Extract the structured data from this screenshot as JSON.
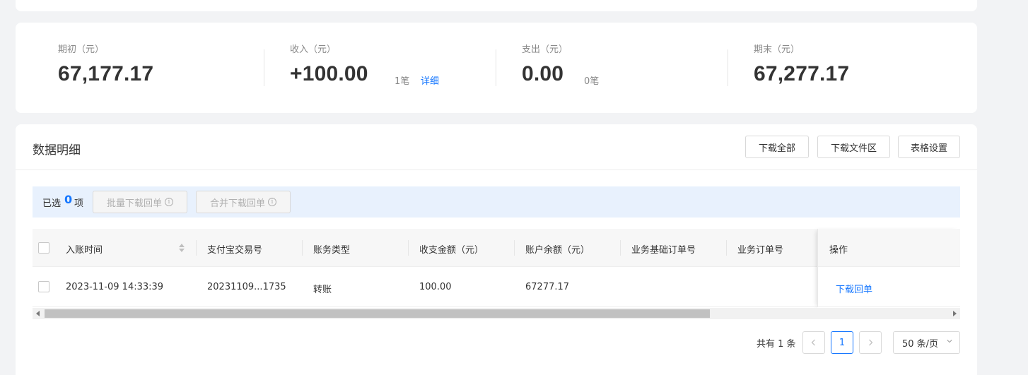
{
  "summary": {
    "opening": {
      "label": "期初（元）",
      "value": "67,177.17"
    },
    "income": {
      "label": "收入（元）",
      "value": "+100.00",
      "count": "1笔",
      "link": "详细"
    },
    "expense": {
      "label": "支出（元）",
      "value": "0.00",
      "count": "0笔"
    },
    "closing": {
      "label": "期末（元）",
      "value": "67,277.17"
    }
  },
  "detail": {
    "title": "数据明细",
    "buttons": {
      "download_all": "下载全部",
      "download_area": "下载文件区",
      "table_settings": "表格设置"
    },
    "selection": {
      "prefix": "已选",
      "count": "0",
      "suffix": "项",
      "batch_download": "批量下载回单",
      "merge_download": "合并下载回单"
    },
    "columns": [
      "入账时间",
      "支付宝交易号",
      "账务类型",
      "收支金额（元）",
      "账户余额（元）",
      "业务基础订单号",
      "业务订单号",
      "操作"
    ],
    "rows": [
      {
        "time": "2023-11-09 14:33:39",
        "trade_no": "20231109...1735",
        "type": "转账",
        "amount": "100.00",
        "balance": "67277.17",
        "base_order": "",
        "order": "",
        "action": "下载回单"
      }
    ],
    "pagination": {
      "total": "共有 1 条",
      "current_page": "1",
      "page_size": "50 条/页"
    }
  }
}
